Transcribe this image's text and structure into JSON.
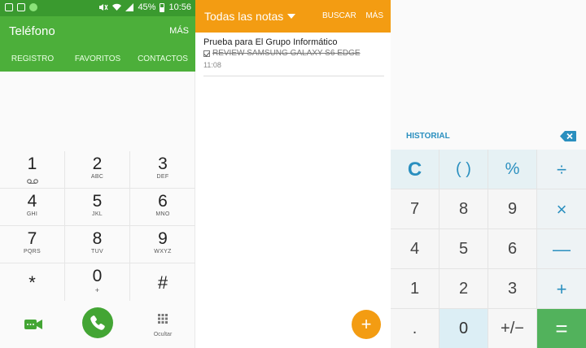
{
  "status_bar": {
    "battery": "45%",
    "time": "10:56"
  },
  "phone": {
    "title": "Teléfono",
    "more": "MÁS",
    "tabs": [
      "REGISTRO",
      "FAVORITOS",
      "CONTACTOS"
    ],
    "keys": [
      {
        "num": "1",
        "sub": ""
      },
      {
        "num": "2",
        "sub": "ABC"
      },
      {
        "num": "3",
        "sub": "DEF"
      },
      {
        "num": "4",
        "sub": "GHI"
      },
      {
        "num": "5",
        "sub": "JKL"
      },
      {
        "num": "6",
        "sub": "MNO"
      },
      {
        "num": "7",
        "sub": "PQRS"
      },
      {
        "num": "8",
        "sub": "TUV"
      },
      {
        "num": "9",
        "sub": "WXYZ"
      },
      {
        "num": "*",
        "sub": ""
      },
      {
        "num": "0",
        "sub": "+"
      },
      {
        "num": "#",
        "sub": ""
      }
    ],
    "hide_label": "Ocultar",
    "accent": "#4caf3a"
  },
  "notes": {
    "title": "Todas las notas",
    "search": "BUSCAR",
    "more": "MÁS",
    "item": {
      "title": "Prueba para El Grupo Informático",
      "task": "REVIEW SAMSUNG GALAXY S6 EDGE",
      "time": "11:08"
    },
    "fab": "+",
    "accent": "#f39c12"
  },
  "calculator": {
    "history": "HISTORIAL",
    "keys": [
      {
        "label": "C",
        "kind": "row0 cbig"
      },
      {
        "label": "( )",
        "kind": "row0"
      },
      {
        "label": "%",
        "kind": "row0"
      },
      {
        "label": "÷",
        "kind": "op"
      },
      {
        "label": "7",
        "kind": ""
      },
      {
        "label": "8",
        "kind": ""
      },
      {
        "label": "9",
        "kind": ""
      },
      {
        "label": "×",
        "kind": "op"
      },
      {
        "label": "4",
        "kind": ""
      },
      {
        "label": "5",
        "kind": ""
      },
      {
        "label": "6",
        "kind": ""
      },
      {
        "label": "—",
        "kind": "op"
      },
      {
        "label": "1",
        "kind": ""
      },
      {
        "label": "2",
        "kind": ""
      },
      {
        "label": "3",
        "kind": ""
      },
      {
        "label": "+",
        "kind": "op"
      },
      {
        "label": ".",
        "kind": ""
      },
      {
        "label": "0",
        "kind": "zero"
      },
      {
        "label": "+/−",
        "kind": ""
      },
      {
        "label": "=",
        "kind": "eq"
      }
    ],
    "accent": "#2a8fbf",
    "equals_color": "#52b25c"
  }
}
